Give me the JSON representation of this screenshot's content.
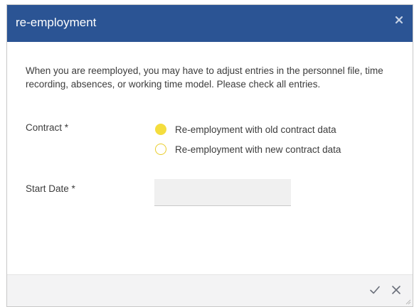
{
  "dialog": {
    "title": "re-employment",
    "description": "When you are reemployed, you may have to adjust entries in the personnel file, time recording, absences, or working time model. Please check all entries."
  },
  "form": {
    "contract_label": "Contract *",
    "contract_options": [
      {
        "label": "Re-employment with old contract data",
        "selected": true
      },
      {
        "label": "Re-employment with new contract data",
        "selected": false
      }
    ],
    "start_date_label": "Start Date *",
    "start_date_value": ""
  },
  "colors": {
    "title_bar": "#2b5494",
    "radio_accent": "#f4dd3e",
    "footer_bg": "#f3f3f4"
  },
  "icons": {
    "close": "close-icon",
    "confirm": "checkmark-icon",
    "cancel": "close-icon",
    "resize": "resize-grip-icon"
  }
}
